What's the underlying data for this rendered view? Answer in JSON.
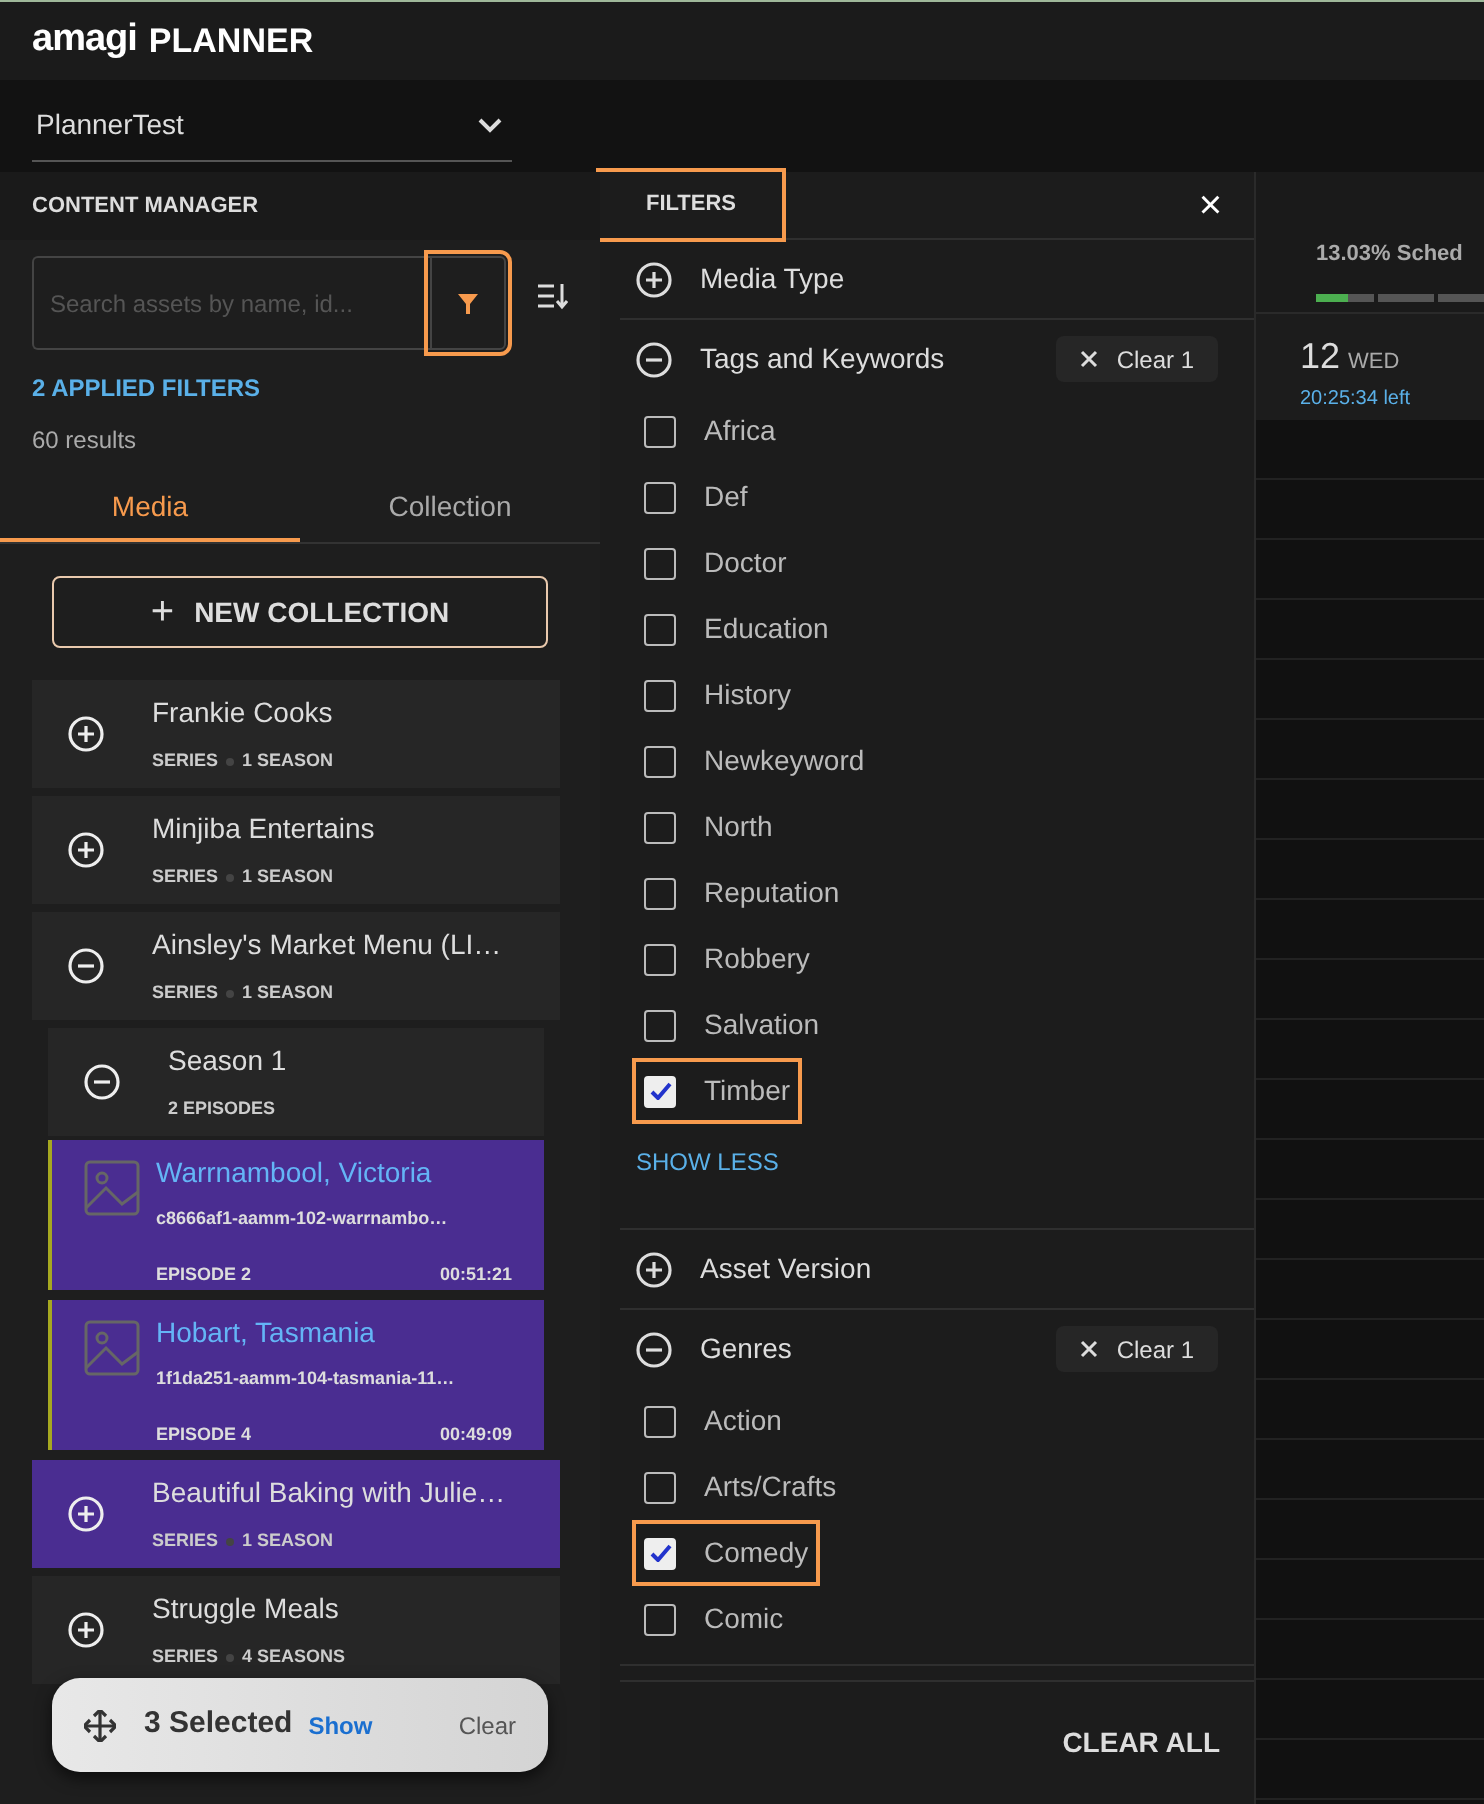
{
  "app": {
    "logo": "amagi",
    "title": "PLANNER"
  },
  "channel_select": {
    "value": "PlannerTest"
  },
  "content_manager": {
    "title": "CONTENT MANAGER",
    "search": {
      "placeholder": "Search assets by name, id..."
    },
    "filter_button": {
      "highlighted": true
    },
    "applied_filters": "2 APPLIED FILTERS",
    "results": "60 results",
    "tabs": [
      {
        "label": "Media",
        "selected": true
      },
      {
        "label": "Collection",
        "selected": false
      }
    ],
    "new_collection": {
      "icon": "+",
      "label": "NEW COLLECTION"
    },
    "items": [
      {
        "kind": "series",
        "title": "Frankie Cooks",
        "meta": [
          "SERIES",
          "1 SEASON"
        ],
        "expanded": false,
        "selected": false
      },
      {
        "kind": "series",
        "title": "Minjiba Entertains",
        "meta": [
          "SERIES",
          "1 SEASON"
        ],
        "expanded": false,
        "selected": false
      },
      {
        "kind": "series",
        "title": "Ainsley's Market Menu (LI…",
        "meta": [
          "SERIES",
          "1 SEASON"
        ],
        "expanded": true,
        "selected": false,
        "children": [
          {
            "kind": "season",
            "title": "Season 1",
            "meta": [
              "2 EPISODES"
            ],
            "expanded": true,
            "selected": false,
            "children": [
              {
                "kind": "episode",
                "title": "Warrnambool, Victoria",
                "asset_id": "c8666af1-aamm-102-warrnambo…",
                "episode": "EPISODE 2",
                "duration": "00:51:21",
                "selected": true
              },
              {
                "kind": "episode",
                "title": "Hobart, Tasmania",
                "asset_id": "1f1da251-aamm-104-tasmania-11…",
                "episode": "EPISODE 4",
                "duration": "00:49:09",
                "selected": true
              }
            ]
          }
        ]
      },
      {
        "kind": "series",
        "title": "Beautiful Baking with Julie…",
        "meta": [
          "SERIES",
          "1 SEASON"
        ],
        "expanded": false,
        "selected": true
      },
      {
        "kind": "series",
        "title": "Struggle Meals",
        "meta": [
          "SERIES",
          "4 SEASONS"
        ],
        "expanded": false,
        "selected": false
      }
    ],
    "selection_bar": {
      "count": "3 Selected",
      "show": "Show",
      "clear": "Clear"
    }
  },
  "filters": {
    "title": "FILTERS",
    "highlighted": true,
    "close": "×",
    "sections": [
      {
        "label": "Media Type",
        "expanded": false
      },
      {
        "label": "Tags and Keywords",
        "expanded": true,
        "clear": "Clear 1",
        "options": [
          {
            "label": "Africa",
            "checked": false,
            "highlighted": false
          },
          {
            "label": "Def",
            "checked": false,
            "highlighted": false
          },
          {
            "label": "Doctor",
            "checked": false,
            "highlighted": false
          },
          {
            "label": "Education",
            "checked": false,
            "highlighted": false
          },
          {
            "label": "History",
            "checked": false,
            "highlighted": false
          },
          {
            "label": "Newkeyword",
            "checked": false,
            "highlighted": false
          },
          {
            "label": "North",
            "checked": false,
            "highlighted": false
          },
          {
            "label": "Reputation",
            "checked": false,
            "highlighted": false
          },
          {
            "label": "Robbery",
            "checked": false,
            "highlighted": false
          },
          {
            "label": "Salvation",
            "checked": false,
            "highlighted": false
          },
          {
            "label": "Timber",
            "checked": true,
            "highlighted": true
          }
        ],
        "toggle": "SHOW LESS"
      },
      {
        "label": "Asset Version",
        "expanded": false
      },
      {
        "label": "Genres",
        "expanded": true,
        "clear": "Clear 1",
        "options": [
          {
            "label": "Action",
            "checked": false,
            "highlighted": false
          },
          {
            "label": "Arts/Crafts",
            "checked": false,
            "highlighted": false
          },
          {
            "label": "Comedy",
            "checked": true,
            "highlighted": true
          },
          {
            "label": "Comic",
            "checked": false,
            "highlighted": false
          }
        ]
      }
    ],
    "clear_all": "CLEAR ALL"
  },
  "schedule": {
    "stat": "13.03% Sched",
    "level": 0.13,
    "day": "12",
    "weekday": "WED",
    "remaining": "20:25:34 left"
  }
}
